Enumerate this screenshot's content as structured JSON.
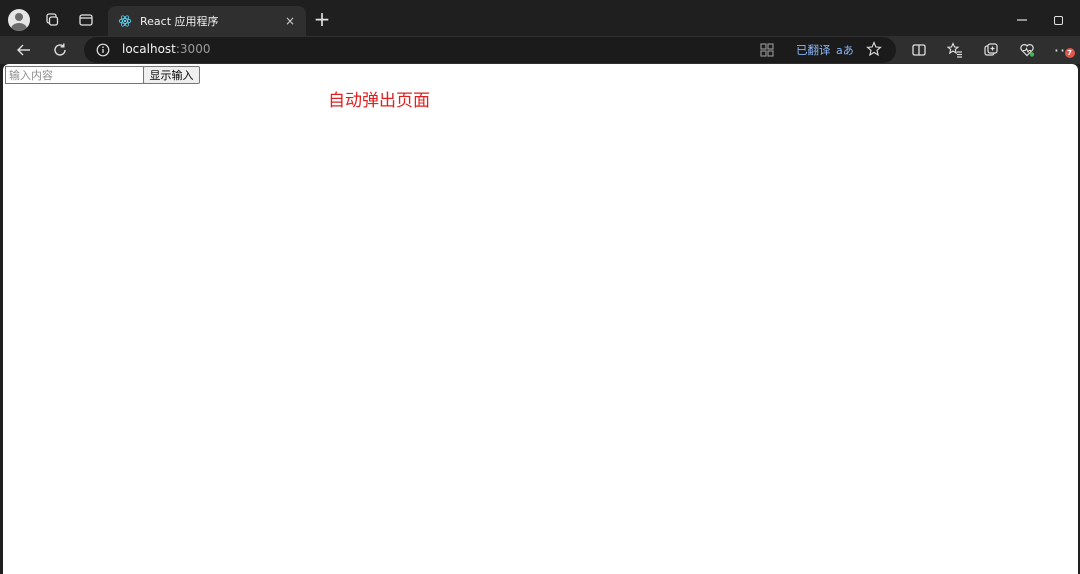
{
  "tab": {
    "title": "React 应用程序",
    "close": "×",
    "new_tab": "+"
  },
  "window": {
    "minimize": "—"
  },
  "toolbar": {
    "url_host": "localhost",
    "url_port": ":3000",
    "translated_label": "已翻译",
    "translate_icon": "aあ",
    "more": "···",
    "badge": "7"
  },
  "page": {
    "input_placeholder": "输入内容",
    "input_value": "",
    "button_label": "显示输入",
    "popup_text": "自动弹出页面"
  },
  "colors": {
    "popup_text": "#e02020",
    "translated": "#8ab4f8",
    "badge": "#e0564b"
  },
  "icons": {
    "profile": "profile-icon",
    "workspaces": "workspaces-icon",
    "tab_actions": "tab-actions-icon",
    "favicon": "react-icon",
    "back": "back-arrow-icon",
    "reload": "reload-icon",
    "site_info": "info-icon",
    "apps": "apps-icon",
    "star": "star-icon",
    "split": "split-screen-icon",
    "favorites": "favorites-icon",
    "collections": "collections-icon",
    "health": "browser-essentials-icon"
  }
}
